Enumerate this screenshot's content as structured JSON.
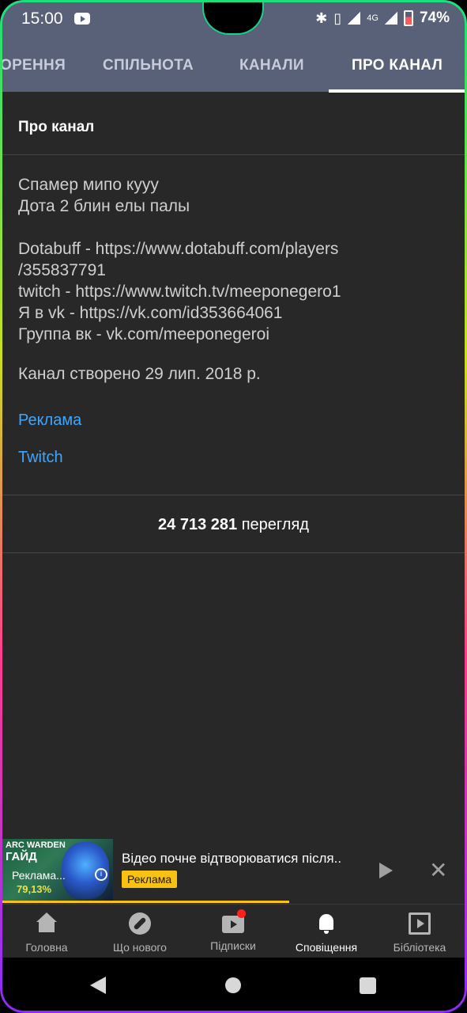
{
  "status_bar": {
    "time": "15:00",
    "network": "4G",
    "battery": "74%",
    "icons": [
      "youtube-icon",
      "bluetooth-icon",
      "vibrate-icon",
      "signal-icon",
      "battery-icon"
    ]
  },
  "tabs": [
    {
      "label": "ОРЕННЯ"
    },
    {
      "label": "СПІЛЬНОТА"
    },
    {
      "label": "КАНАЛИ"
    },
    {
      "label": "ПРО КАНАЛ",
      "active": true
    }
  ],
  "about": {
    "title": "Про канал",
    "description_lines": [
      "Спамер мипо кууу",
      "Дота 2 блин елы палы",
      "Dotabuff - https://www.dotabuff.com/players",
      "/355837791",
      "twitch - https://www.twitch.tv/meeponegero1",
      "Я в vk - https://vk.com/id353664061",
      "Группа вк - vk.com/meeponegeroi"
    ],
    "created": "Канал створено 29 лип. 2018 р.",
    "links": [
      "Реклама",
      "Twitch"
    ],
    "views_count": "24 713 281",
    "views_label": "перегляд"
  },
  "mini_player": {
    "thumb_text_1": "ARC WARDEN",
    "thumb_text_2": "ГАЙД",
    "thumb_text_3": "79,13%",
    "thumb_text_4": "Реклама...",
    "title": "Відео почне відтворюватися після..",
    "badge": "Реклама",
    "progress": 0.62,
    "accent": "#f9c213"
  },
  "bottom_nav": [
    {
      "label": "Головна",
      "icon": "home-icon"
    },
    {
      "label": "Що нового",
      "icon": "explore-icon"
    },
    {
      "label": "Підписки",
      "icon": "subscriptions-icon"
    },
    {
      "label": "Сповіщення",
      "icon": "bell-icon",
      "active": true
    },
    {
      "label": "Бібліотека",
      "icon": "library-icon"
    }
  ]
}
